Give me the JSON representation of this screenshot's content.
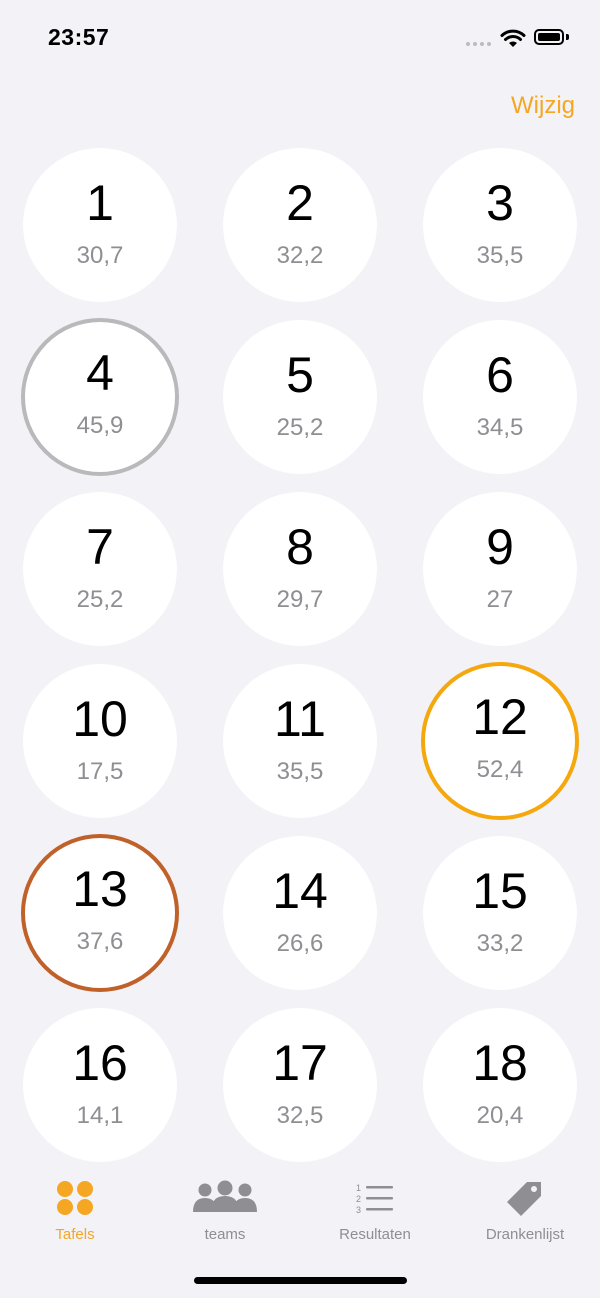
{
  "status_bar": {
    "time": "23:57"
  },
  "header": {
    "edit_label": "Wijzig"
  },
  "tables": [
    {
      "number": "1",
      "score": "30,7",
      "ring": ""
    },
    {
      "number": "2",
      "score": "32,2",
      "ring": ""
    },
    {
      "number": "3",
      "score": "35,5",
      "ring": ""
    },
    {
      "number": "4",
      "score": "45,9",
      "ring": "gray"
    },
    {
      "number": "5",
      "score": "25,2",
      "ring": ""
    },
    {
      "number": "6",
      "score": "34,5",
      "ring": ""
    },
    {
      "number": "7",
      "score": "25,2",
      "ring": ""
    },
    {
      "number": "8",
      "score": "29,7",
      "ring": ""
    },
    {
      "number": "9",
      "score": "27",
      "ring": ""
    },
    {
      "number": "10",
      "score": "17,5",
      "ring": ""
    },
    {
      "number": "11",
      "score": "35,5",
      "ring": ""
    },
    {
      "number": "12",
      "score": "52,4",
      "ring": "gold"
    },
    {
      "number": "13",
      "score": "37,6",
      "ring": "bronze"
    },
    {
      "number": "14",
      "score": "26,6",
      "ring": ""
    },
    {
      "number": "15",
      "score": "33,2",
      "ring": ""
    },
    {
      "number": "16",
      "score": "14,1",
      "ring": ""
    },
    {
      "number": "17",
      "score": "32,5",
      "ring": ""
    },
    {
      "number": "18",
      "score": "20,4",
      "ring": ""
    }
  ],
  "tab_bar": {
    "tabs": [
      {
        "label": "Tafels",
        "icon": "tables-grid-icon",
        "active": true
      },
      {
        "label": "teams",
        "icon": "people-icon",
        "active": false
      },
      {
        "label": "Resultaten",
        "icon": "numbered-list-icon",
        "active": false
      },
      {
        "label": "Drankenlijst",
        "icon": "price-tag-icon",
        "active": false
      }
    ]
  },
  "colors": {
    "accent": "#f5a623",
    "gold_ring": "#f5a70e",
    "silver_ring": "#b9b9bb",
    "bronze_ring": "#c0612a",
    "background": "#f2f2f7"
  }
}
